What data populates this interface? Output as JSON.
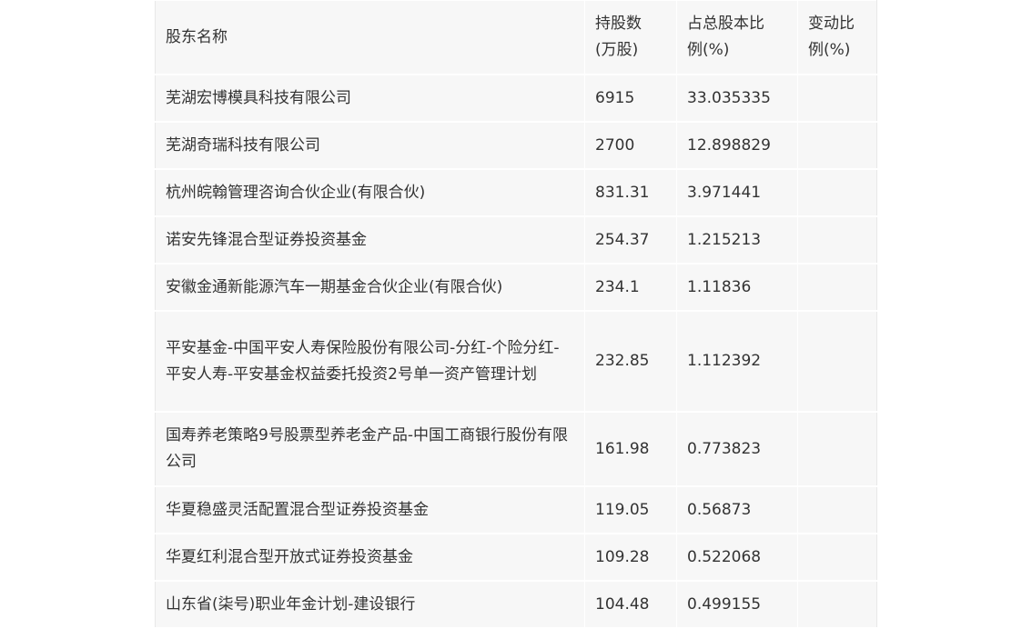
{
  "table": {
    "headers": [
      "股东名称",
      "持股数(万股)",
      "占总股本比例(%)",
      "变动比例(%)"
    ],
    "header_lines": [
      [
        "股东名称"
      ],
      [
        "持股数",
        "(万股)"
      ],
      [
        "占总股本比",
        "例(%)"
      ],
      [
        "变动比",
        "例(%)"
      ]
    ],
    "rows": [
      {
        "name": "芜湖宏博模具科技有限公司",
        "shares": "6915",
        "ratio": "33.035335",
        "change": ""
      },
      {
        "name": "芜湖奇瑞科技有限公司",
        "shares": "2700",
        "ratio": "12.898829",
        "change": ""
      },
      {
        "name": "杭州皖翰管理咨询合伙企业(有限合伙)",
        "shares": "831.31",
        "ratio": "3.971441",
        "change": ""
      },
      {
        "name": "诺安先锋混合型证券投资基金",
        "shares": "254.37",
        "ratio": "1.215213",
        "change": ""
      },
      {
        "name": "安徽金通新能源汽车一期基金合伙企业(有限合伙)",
        "shares": "234.1",
        "ratio": "1.11836",
        "change": ""
      },
      {
        "name": "平安基金-中国平安人寿保险股份有限公司-分红-个险分红-平安人寿-平安基金权益委托投资2号单一资产管理计划",
        "shares": "232.85",
        "ratio": "1.112392",
        "change": ""
      },
      {
        "name": "国寿养老策略9号股票型养老金产品-中国工商银行股份有限公司",
        "shares": "161.98",
        "ratio": "0.773823",
        "change": ""
      },
      {
        "name": "华夏稳盛灵活配置混合型证券投资基金",
        "shares": "119.05",
        "ratio": "0.56873",
        "change": ""
      },
      {
        "name": "华夏红利混合型开放式证券投资基金",
        "shares": "109.28",
        "ratio": "0.522068",
        "change": ""
      },
      {
        "name": "山东省(柒号)职业年金计划-建设银行",
        "shares": "104.48",
        "ratio": "0.499155",
        "change": ""
      }
    ]
  }
}
